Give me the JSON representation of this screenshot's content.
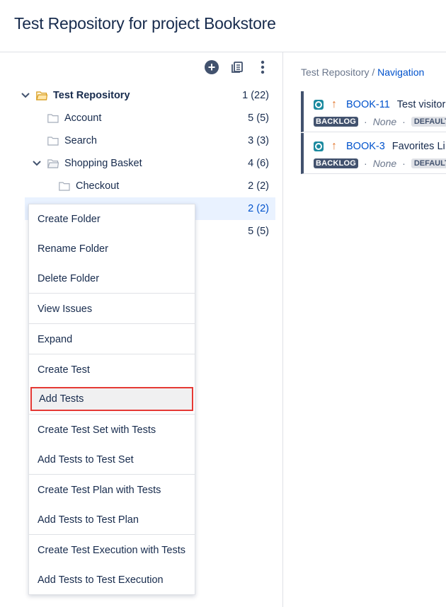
{
  "page": {
    "title": "Test Repository for project Bookstore"
  },
  "toolbar": {
    "add_icon": "plus-circle-icon",
    "docs_icon": "documents-icon",
    "more_icon": "more-vertical-icon"
  },
  "tree": {
    "root": {
      "label": "Test Repository",
      "count": "1 (22)"
    },
    "items": [
      {
        "label": "Account",
        "count": "5 (5)"
      },
      {
        "label": "Search",
        "count": "3 (3)"
      },
      {
        "label": "Shopping Basket",
        "count": "4 (6)"
      },
      {
        "label": "Checkout",
        "count": "2 (2)"
      },
      {
        "label": "",
        "count": "2 (2)"
      },
      {
        "label": "",
        "count": "5 (5)"
      }
    ]
  },
  "breadcrumb": {
    "root": "Test Repository",
    "separator": " / ",
    "current": "Navigation"
  },
  "issues": [
    {
      "key": "BOOK-11",
      "summary": "Test visitor",
      "status": "BACKLOG",
      "dot": "·",
      "assignee": "None",
      "badge": "DEFAULT"
    },
    {
      "key": "BOOK-3",
      "summary": "Favorites Li",
      "status": "BACKLOG",
      "dot": "·",
      "assignee": "None",
      "badge": "DEFAULT"
    }
  ],
  "context_menu": {
    "items": [
      "Create Folder",
      "Rename Folder",
      "Delete Folder",
      "View Issues",
      "Expand",
      "Create Test",
      "Add Tests",
      "Create Test Set with Tests",
      "Add Tests to Test Set",
      "Create Test Plan with Tests",
      "Add Tests to Test Plan",
      "Create Test Execution with Tests",
      "Add Tests to Test Execution"
    ],
    "highlighted": "Add Tests"
  },
  "colors": {
    "link": "#0052cc",
    "text": "#172b4d",
    "muted": "#6b778c",
    "selected_bg": "#e9f2ff",
    "highlight_border": "#e53935",
    "status_badge": "#42526e",
    "priority": "#e2762c",
    "test_type": "#1b8a9f"
  }
}
